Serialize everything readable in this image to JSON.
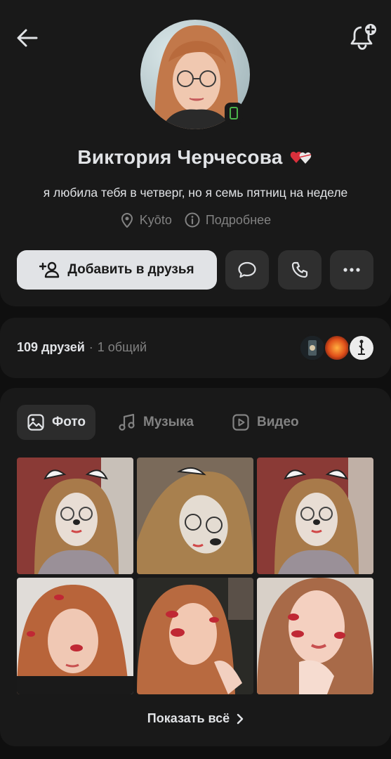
{
  "header": {
    "back_icon": "arrow-left-icon",
    "notify_icon": "bell-plus-icon"
  },
  "profile": {
    "name": "Виктория Черчесова",
    "name_badge_icon": "hearts-emoji-icon",
    "status": "я любила тебя в четверг, но я семь пятниц на неделе",
    "location": "Kyōto",
    "details_label": "Подробнее",
    "online_icon": "mobile-online-icon"
  },
  "actions": {
    "add_friend_label": "Добавить в друзья",
    "message_icon": "message-icon",
    "call_icon": "phone-icon",
    "more_icon": "more-horizontal-icon"
  },
  "friends": {
    "count_label": "109 друзей",
    "separator": "·",
    "mutual_label": "1 общий"
  },
  "media": {
    "tabs": [
      {
        "label": "Фото",
        "icon": "image-icon",
        "active": true
      },
      {
        "label": "Музыка",
        "icon": "music-note-icon",
        "active": false
      },
      {
        "label": "Видео",
        "icon": "play-square-icon",
        "active": false
      }
    ],
    "show_all_label": "Показать всё"
  },
  "colors": {
    "background": "#0f0f0f",
    "card": "#191919",
    "primary_text": "#e1e3e6",
    "secondary_text": "#828282",
    "button_secondary": "#2f2f2f",
    "online": "#4bb34b"
  }
}
